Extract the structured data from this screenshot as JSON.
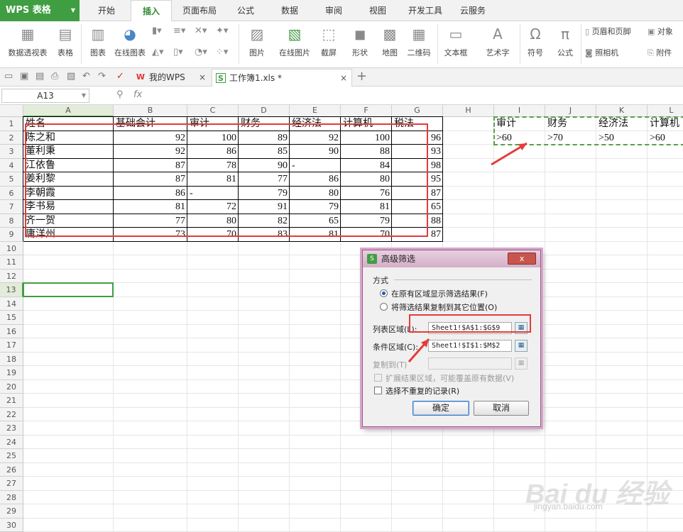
{
  "app": {
    "name": "WPS 表格"
  },
  "menu_tabs": [
    "开始",
    "插入",
    "页面布局",
    "公式",
    "数据",
    "审阅",
    "视图",
    "开发工具",
    "云服务"
  ],
  "active_tab": "插入",
  "ribbon": {
    "pivot": "数据透视表",
    "table": "表格",
    "chart": "图表",
    "online_chart": "在线图表",
    "picture": "图片",
    "online_picture": "在线图片",
    "screenshot": "截屏",
    "shape": "形状",
    "map": "地图",
    "qrcode": "二维码",
    "textbox": "文本框",
    "wordart": "艺术字",
    "symbol": "符号",
    "formula": "公式",
    "header_footer": "页眉和页脚",
    "object": "对象",
    "camera": "照相机",
    "attachment": "附件"
  },
  "doc_tabs": [
    {
      "label": "我的WPS",
      "close": "×"
    },
    {
      "label": "工作簿1.xls *",
      "close": "×"
    }
  ],
  "add_tab": "+",
  "name_box": "A13",
  "fx": "fx",
  "columns": [
    "A",
    "B",
    "C",
    "D",
    "E",
    "F",
    "G",
    "H",
    "I",
    "J",
    "K",
    "L"
  ],
  "rows": [
    "1",
    "2",
    "3",
    "4",
    "5",
    "6",
    "7",
    "8",
    "9",
    "10",
    "11",
    "12",
    "13",
    "14",
    "15",
    "16",
    "17",
    "18",
    "19",
    "20",
    "21",
    "22",
    "23",
    "24",
    "25",
    "26",
    "27",
    "28",
    "29",
    "30"
  ],
  "table": {
    "headers": [
      "姓名",
      "基础会计",
      "审计",
      "财务",
      "经济法",
      "计算机",
      "税法"
    ],
    "rows": [
      [
        "陈之和",
        "92",
        "100",
        "89",
        "92",
        "100",
        "96"
      ],
      [
        "董利秉",
        "92",
        "86",
        "85",
        "90",
        "88",
        "93"
      ],
      [
        "江依鲁",
        "87",
        "78",
        "90",
        "-",
        "84",
        "98"
      ],
      [
        "姜利黎",
        "87",
        "81",
        "77",
        "86",
        "80",
        "95"
      ],
      [
        "李朝霞",
        "86",
        "-",
        "79",
        "80",
        "76",
        "87"
      ],
      [
        "李书易",
        "81",
        "72",
        "91",
        "79",
        "81",
        "65"
      ],
      [
        "齐一贺",
        "77",
        "80",
        "82",
        "65",
        "79",
        "88"
      ],
      [
        "庸洋州",
        "73",
        "70",
        "83",
        "81",
        "70",
        "87"
      ]
    ]
  },
  "criteria": {
    "headers": [
      "审计",
      "财务",
      "经济法",
      "计算机"
    ],
    "values": [
      ">60",
      ">70",
      ">50",
      ">60"
    ]
  },
  "dialog": {
    "title": "高级筛选",
    "close": "x",
    "mode_label": "方式",
    "option1": "在原有区域显示筛选结果(F)",
    "option2": "将筛选结果复制到其它位置(O)",
    "list_range_label": "列表区域(L):",
    "list_range_value": "Sheet1!$A$1:$G$9",
    "criteria_range_label": "条件区域(C):",
    "criteria_range_value": "Sheet1!$I$1:$M$2",
    "copy_to_label": "复制到(T)",
    "expand_label": "扩展结果区域，可能覆盖原有数据(V)",
    "unique_label": "选择不重复的记录(R)",
    "ok": "确定",
    "cancel": "取消"
  },
  "watermark": {
    "main": "Bai du 经验",
    "sub": "jingyan.baidu.com"
  }
}
